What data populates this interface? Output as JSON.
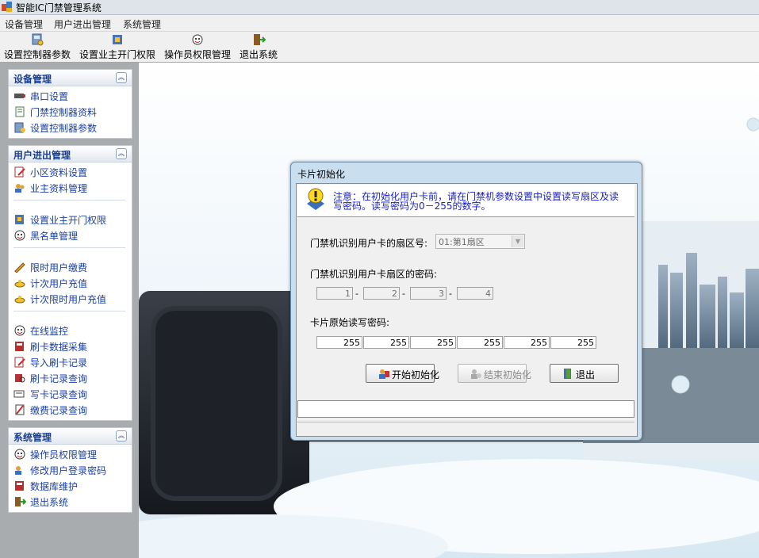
{
  "window": {
    "title": "智能IC门禁管理系统"
  },
  "menu": [
    "设备管理",
    "用户进出管理",
    "系统管理"
  ],
  "toolbar": [
    {
      "label": "设置控制器参数",
      "icon": "device-settings-icon"
    },
    {
      "label": "设置业主开门权限",
      "icon": "door-permission-icon"
    },
    {
      "label": "操作员权限管理",
      "icon": "operator-face-icon"
    },
    {
      "label": "退出系统",
      "icon": "exit-door-icon"
    }
  ],
  "sidebar": {
    "device": {
      "title": "设备管理",
      "items": [
        "串口设置",
        "门禁控制器资料",
        "设置控制器参数"
      ]
    },
    "user": {
      "title": "用户进出管理",
      "items": [
        "小区资料设置",
        "业主资料管理",
        "设置业主开门权限",
        "黑名单管理",
        "限时用户缴费",
        "计次用户充值",
        "计次限时用户充值",
        "在线监控",
        "刷卡数据采集",
        "导入刷卡记录",
        "刷卡记录查询",
        "写卡记录查询",
        "缴费记录查询"
      ]
    },
    "system": {
      "title": "系统管理",
      "items": [
        "操作员权限管理",
        "修改用户登录密码",
        "数据库维护",
        "退出系统"
      ]
    }
  },
  "dialog": {
    "title": "卡片初始化",
    "notice": "注意：在初始化用户卡前，请在门禁机参数设置中设置读写扇区及读写密码。读写密码为0－255的数字。",
    "sector_label": "门禁机识别用户卡的扇区号:",
    "sector_value": "01:第1扇区",
    "sector_password_label": "门禁机识别用户卡扇区的密码:",
    "sector_password": [
      "1",
      "2",
      "3",
      "4"
    ],
    "original_password_label": "卡片原始读写密码:",
    "original_password": [
      "255",
      "255",
      "255",
      "255",
      "255",
      "255"
    ],
    "buttons": {
      "start": "开始初始化",
      "stop": "结束初始化",
      "exit": "退出"
    }
  }
}
